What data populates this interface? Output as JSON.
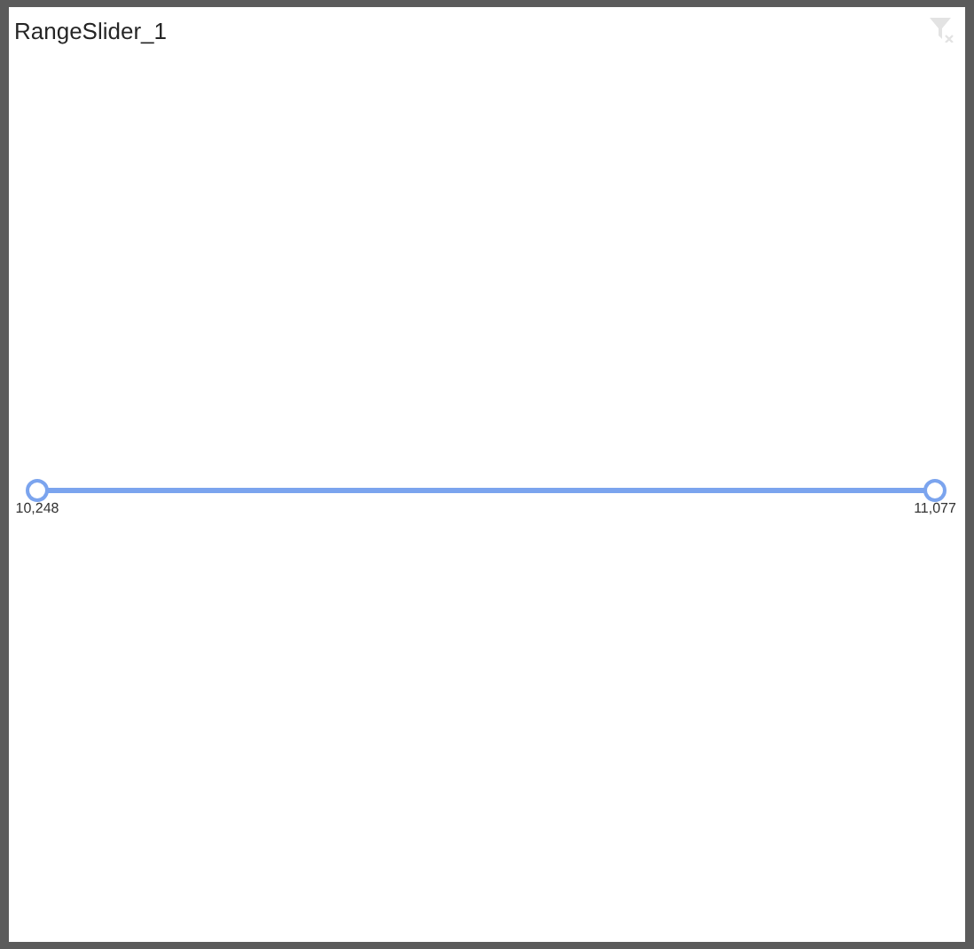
{
  "visual": {
    "title": "RangeSlider_1"
  },
  "slider": {
    "low": {
      "level": 0,
      "reading": "10,248"
    },
    "high": {
      "level": 1,
      "reading": "11,077"
    }
  }
}
